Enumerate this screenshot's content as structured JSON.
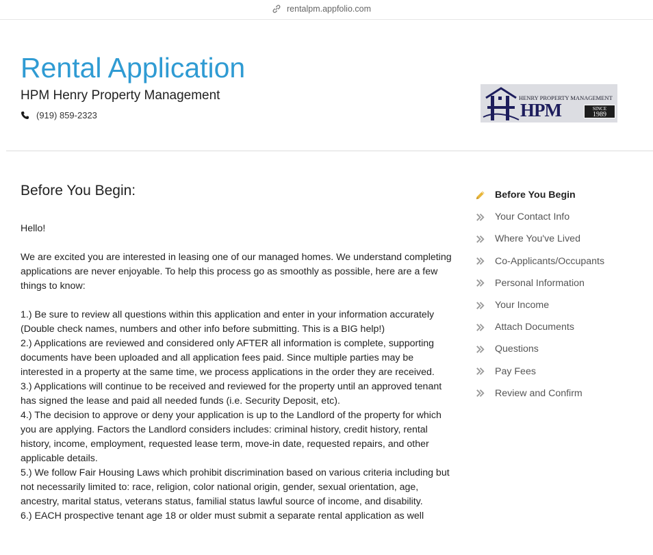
{
  "browser": {
    "url": "rentalpm.appfolio.com"
  },
  "header": {
    "title": "Rental Application",
    "company": "HPM Henry Property Management",
    "phone": "(919) 859-2323",
    "logo": {
      "top_text": "HENRY PROPERTY MANAGEMENT",
      "main_text": "HPM",
      "since_label": "SINCE",
      "since_year": "1989"
    }
  },
  "main": {
    "heading": "Before You Begin:",
    "greeting": "Hello!",
    "intro": "We are excited you are interested in leasing one of our managed homes. We understand completing applications are never enjoyable. To help this process go as smoothly as possible, here are a few things to know:",
    "items": [
      "1.) Be sure to review all questions within this application and enter in your information accurately (Double check names, numbers and other info before submitting. This is a BIG help!)",
      "2.) Applications are reviewed and considered only AFTER all information is complete, supporting documents have been uploaded and all application fees paid. Since multiple parties may be interested in a property at the same time, we process applications in the order they are received.",
      "3.) Applications will continue to be received and reviewed for the property until an approved tenant has signed the lease and paid all needed funds (i.e. Security Deposit, etc).",
      "4.) The decision to approve or deny your application is up to the Landlord of the property for which you are applying. Factors the Landlord considers includes: criminal history, credit history, rental history, income, employment, requested lease term, move-in date, requested repairs, and other applicable details.",
      "5.) We follow Fair Housing Laws which prohibit discrimination based on various criteria including but not necessarily limited to: race, religion, color national origin, gender, sexual orientation, age, ancestry, marital status, veterans status, familial status lawful source of income, and disability.",
      "6.) EACH prospective tenant age 18 or older must submit a separate rental application as well"
    ]
  },
  "steps": [
    {
      "label": "Before You Begin",
      "icon": "pencil-icon",
      "active": true
    },
    {
      "label": "Your Contact Info",
      "icon": "double-chevron-right-icon",
      "active": false
    },
    {
      "label": "Where You've Lived",
      "icon": "double-chevron-right-icon",
      "active": false
    },
    {
      "label": "Co-Applicants/Occupants",
      "icon": "double-chevron-right-icon",
      "active": false
    },
    {
      "label": "Personal Information",
      "icon": "double-chevron-right-icon",
      "active": false
    },
    {
      "label": "Your Income",
      "icon": "double-chevron-right-icon",
      "active": false
    },
    {
      "label": "Attach Documents",
      "icon": "double-chevron-right-icon",
      "active": false
    },
    {
      "label": "Questions",
      "icon": "double-chevron-right-icon",
      "active": false
    },
    {
      "label": "Pay Fees",
      "icon": "double-chevron-right-icon",
      "active": false
    },
    {
      "label": "Review and Confirm",
      "icon": "double-chevron-right-icon",
      "active": false
    }
  ],
  "colors": {
    "title": "#2f9bd3",
    "pencil": "#e8b63a",
    "chevron": "#9a9a9a"
  }
}
